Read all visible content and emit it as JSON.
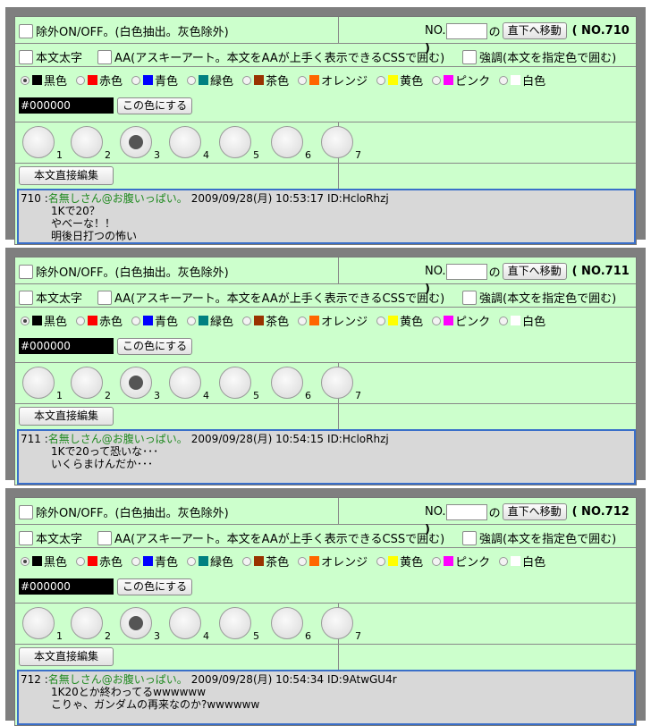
{
  "controls": {
    "exclude_label": "除外ON/OFF。(白色抽出。灰色除外)",
    "no_label": "NO.",
    "no_suffix": "の",
    "jump_button": "直下へ移動",
    "bold_label": "本文太字",
    "aa_label": "AA(アスキーアート。本文をAAが上手く表示できるCSSで囲む)",
    "emphasis_label": "強調(本文を指定色で囲む)",
    "apply_color_button": "この色にする",
    "edit_button": "本文直接編集",
    "hex_value": "#000000"
  },
  "colors": [
    {
      "label": "黒色",
      "hex": "#000000",
      "selected": true
    },
    {
      "label": "赤色",
      "hex": "#ff0000",
      "selected": false
    },
    {
      "label": "青色",
      "hex": "#0000ff",
      "selected": false
    },
    {
      "label": "緑色",
      "hex": "#008080",
      "selected": false
    },
    {
      "label": "茶色",
      "hex": "#993300",
      "selected": false
    },
    {
      "label": "オレンジ",
      "hex": "#ff6600",
      "selected": false
    },
    {
      "label": "黄色",
      "hex": "#ffff00",
      "selected": false
    },
    {
      "label": "ピンク",
      "hex": "#ff00ff",
      "selected": false
    },
    {
      "label": "白色",
      "hex": "#ffffff",
      "selected": false
    }
  ],
  "sizes": [
    "1",
    "2",
    "3",
    "4",
    "5",
    "6",
    "7"
  ],
  "selected_size": "3",
  "posts": [
    {
      "no_badge": "( NO.710 )",
      "number": "710",
      "name": "名無しさん@お腹いっぱい。",
      "date": "2009/09/28(月) 10:53:17",
      "id": "ID:HcloRhzj",
      "lines": [
        "1Kで20？",
        "やべーな！！",
        "明後日打つの怖い"
      ]
    },
    {
      "no_badge": "( NO.711 )",
      "number": "711",
      "name": "名無しさん@お腹いっぱい。",
      "date": "2009/09/28(月) 10:54:15",
      "id": "ID:HcloRhzj",
      "lines": [
        "1Kで20って恐いな･･･",
        "いくらまけんだか･･･"
      ]
    },
    {
      "no_badge": "( NO.712 )",
      "number": "712",
      "name": "名無しさん@お腹いっぱい。",
      "date": "2009/09/28(月) 10:54:34",
      "id": "ID:9AtwGU4r",
      "lines": [
        "1K20とか終わってるwwwwww",
        "こりゃ、ガンダムの再来なのか?wwwwww"
      ]
    }
  ]
}
